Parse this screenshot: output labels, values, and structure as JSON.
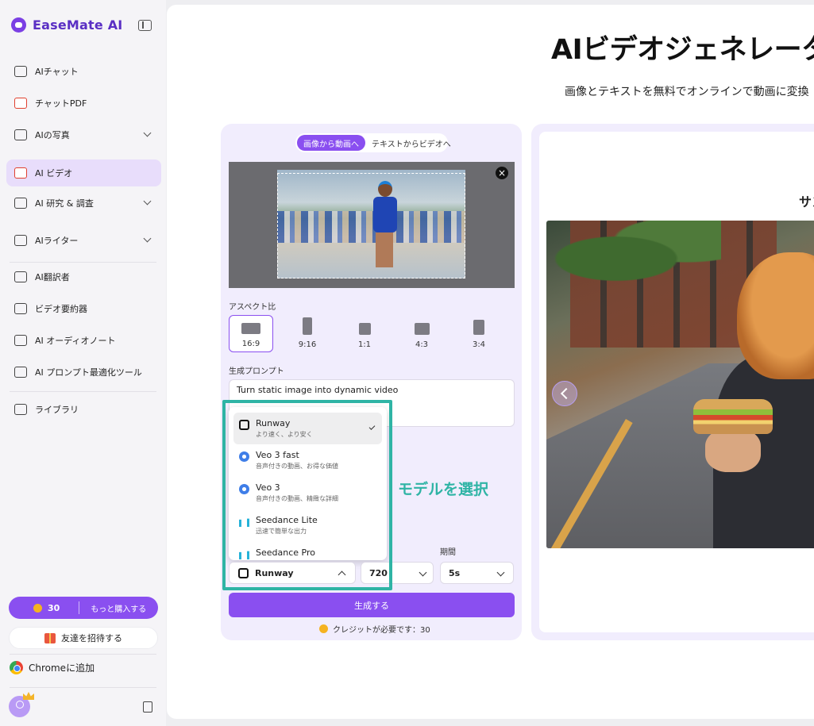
{
  "sidebar": {
    "logo": "EaseMate AI",
    "items": [
      {
        "label": "AIチャット"
      },
      {
        "label": "チャットPDF"
      },
      {
        "label": "AIの写真"
      },
      {
        "label": "AI ビデオ"
      },
      {
        "label": "AI 研究 & 調査"
      },
      {
        "label": "AIライター"
      },
      {
        "label": "AI翻訳者"
      },
      {
        "label": "ビデオ要約器"
      },
      {
        "label": "AI オーディオノート"
      },
      {
        "label": "AI プロンプト最適化ツール"
      },
      {
        "label": "ライブラリ"
      }
    ],
    "credits": "30",
    "buy_more": "もっと購入する",
    "invite": "友達を招待する",
    "add_chrome": "Chromeに追加"
  },
  "main": {
    "title": "AIビデオジェネレーター",
    "subtitle": "画像とテキストを無料でオンラインで動画に変換",
    "tabs": [
      "画像から動画へ",
      "テキストからビデオへ"
    ],
    "aspect_label": "アスペクト比",
    "aspect_options": [
      "16:9",
      "9:16",
      "1:1",
      "4:3",
      "3:4"
    ],
    "prompt_label": "生成プロンプト",
    "prompt_value": "Turn static image into dynamic video",
    "models": [
      {
        "name": "Runway",
        "desc": "より速く、より安く"
      },
      {
        "name": "Veo 3 fast",
        "desc": "音声付きの動画、お得な価値"
      },
      {
        "name": "Veo 3",
        "desc": "音声付きの動画、精緻な詳細"
      },
      {
        "name": "Seedance Lite",
        "desc": "迅速で簡単な出力"
      },
      {
        "name": "Seedance Pro",
        "desc": ""
      }
    ],
    "annotation": "モデルを選択",
    "duration_label": "期間",
    "selected_model": "Runway",
    "resolution": "720",
    "duration": "5s",
    "generate": "生成する",
    "credit_note": "クレジットが必要です：30",
    "sample_label": "サン"
  },
  "colors": {
    "accent": "#8a4ff0",
    "highlight": "#2fb4a5",
    "panel": "#f1edfd"
  }
}
